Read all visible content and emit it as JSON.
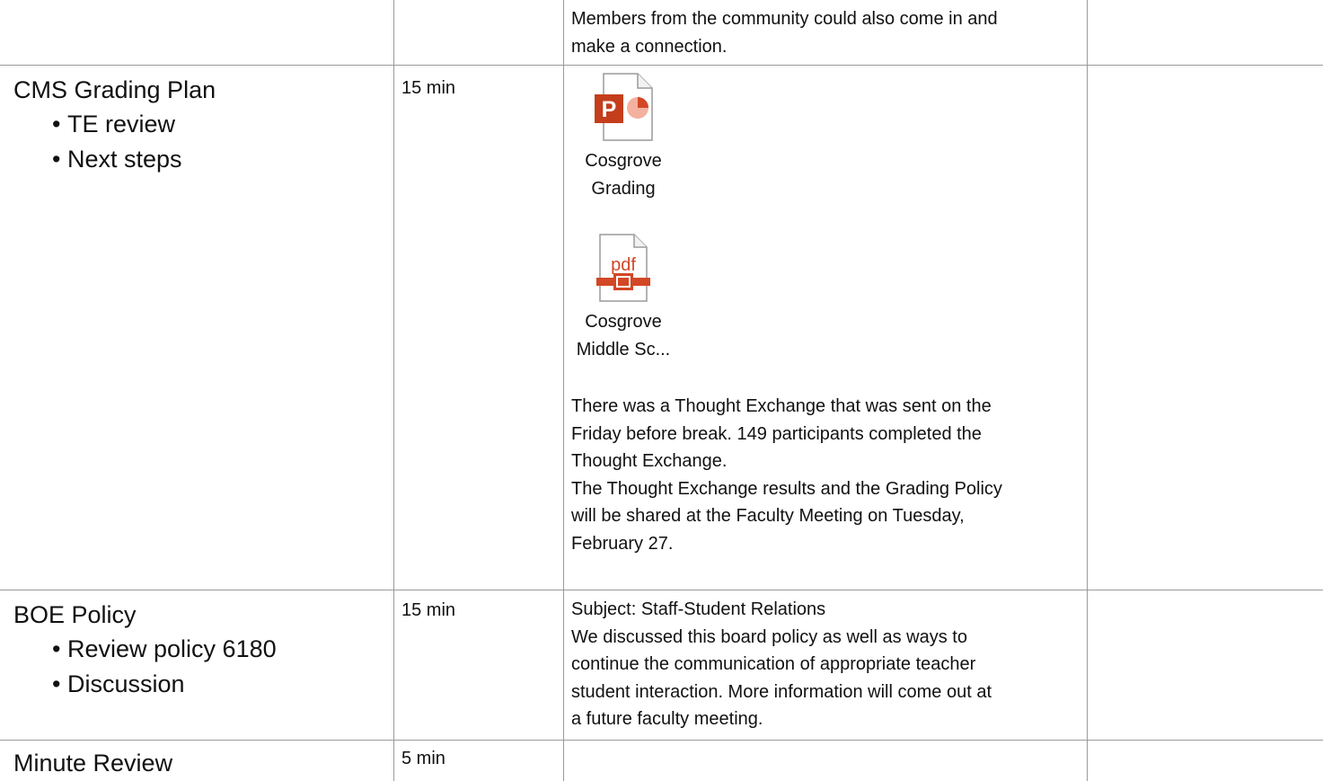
{
  "rows": {
    "prev": {
      "notes": [
        "Members from the community could also come in and",
        "make a connection."
      ]
    },
    "grading": {
      "topic": "CMS Grading Plan",
      "bullets": [
        "TE review",
        "Next steps"
      ],
      "time": "15 min",
      "attachments": [
        {
          "icon": "powerpoint-file-icon",
          "label_lines": [
            "Cosgrove",
            "Grading"
          ]
        },
        {
          "icon": "pdf-file-icon",
          "icon_text": "pdf",
          "label_lines": [
            "Cosgrove",
            "Middle Sc..."
          ]
        }
      ],
      "notes": [
        "There was a Thought Exchange that was sent on the",
        "Friday before break.  149 participants completed the",
        "Thought Exchange.",
        "The Thought Exchange results and the Grading Policy",
        "will be shared at the Faculty Meeting on Tuesday,",
        "February 27."
      ]
    },
    "boe": {
      "topic": "BOE Policy",
      "bullets": [
        "Review policy 6180",
        "Discussion"
      ],
      "time": "15 min",
      "notes": [
        "Subject: Staff-Student Relations",
        "We discussed this board policy as well as ways to",
        "continue the communication of appropriate teacher",
        "student interaction. More information will come out at",
        "a future faculty meeting."
      ]
    },
    "minute": {
      "topic": "Minute Review",
      "time": "5 min"
    }
  },
  "colors": {
    "ppt_red": "#c43e1c",
    "pdf_red": "#d24726",
    "grid": "#9a9a9a"
  }
}
